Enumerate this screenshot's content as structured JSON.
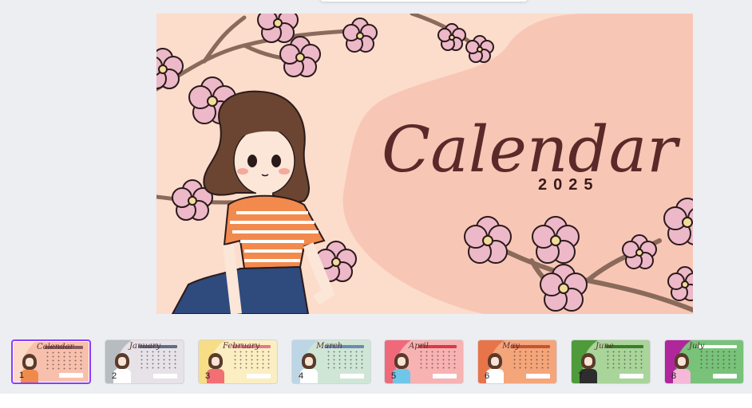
{
  "slide": {
    "title": "Calendar",
    "year": "2025"
  },
  "thumbnails": [
    {
      "number": "1",
      "title": "Calendar",
      "bg": "#fcd9c8",
      "blob": "#f7c0ad",
      "bar": "#8a5a5a",
      "shirt": "#f08a4b",
      "selected": true
    },
    {
      "number": "2",
      "title": "January",
      "bg": "#b7bcc1",
      "blob": "#e6e2e8",
      "bar": "#5f6f84",
      "shirt": "#ffffff",
      "selected": false
    },
    {
      "number": "3",
      "title": "February",
      "bg": "#f6dd86",
      "blob": "#fbeec2",
      "bar": "#e7788a",
      "shirt": "#f26f74",
      "selected": false
    },
    {
      "number": "4",
      "title": "March",
      "bg": "#bcd6e6",
      "blob": "#cfe6d6",
      "bar": "#6b8bb5",
      "shirt": "#ffffff",
      "selected": false
    },
    {
      "number": "5",
      "title": "April",
      "bg": "#f0697a",
      "blob": "#f7b2b2",
      "bar": "#d83a4a",
      "shirt": "#6fc6e8",
      "selected": false
    },
    {
      "number": "6",
      "title": "May",
      "bg": "#e8744a",
      "blob": "#f4a57a",
      "bar": "#c55430",
      "shirt": "#ffffff",
      "selected": false
    },
    {
      "number": "7",
      "title": "June",
      "bg": "#4f9a3a",
      "blob": "#a9d49a",
      "bar": "#3a7d2a",
      "shirt": "#2d2d2d",
      "selected": false
    },
    {
      "number": "8",
      "title": "July",
      "bg": "#b0269b",
      "blob": "#78c27a",
      "bar": "#ffffff",
      "shirt": "#f5b8d9",
      "selected": false
    }
  ]
}
